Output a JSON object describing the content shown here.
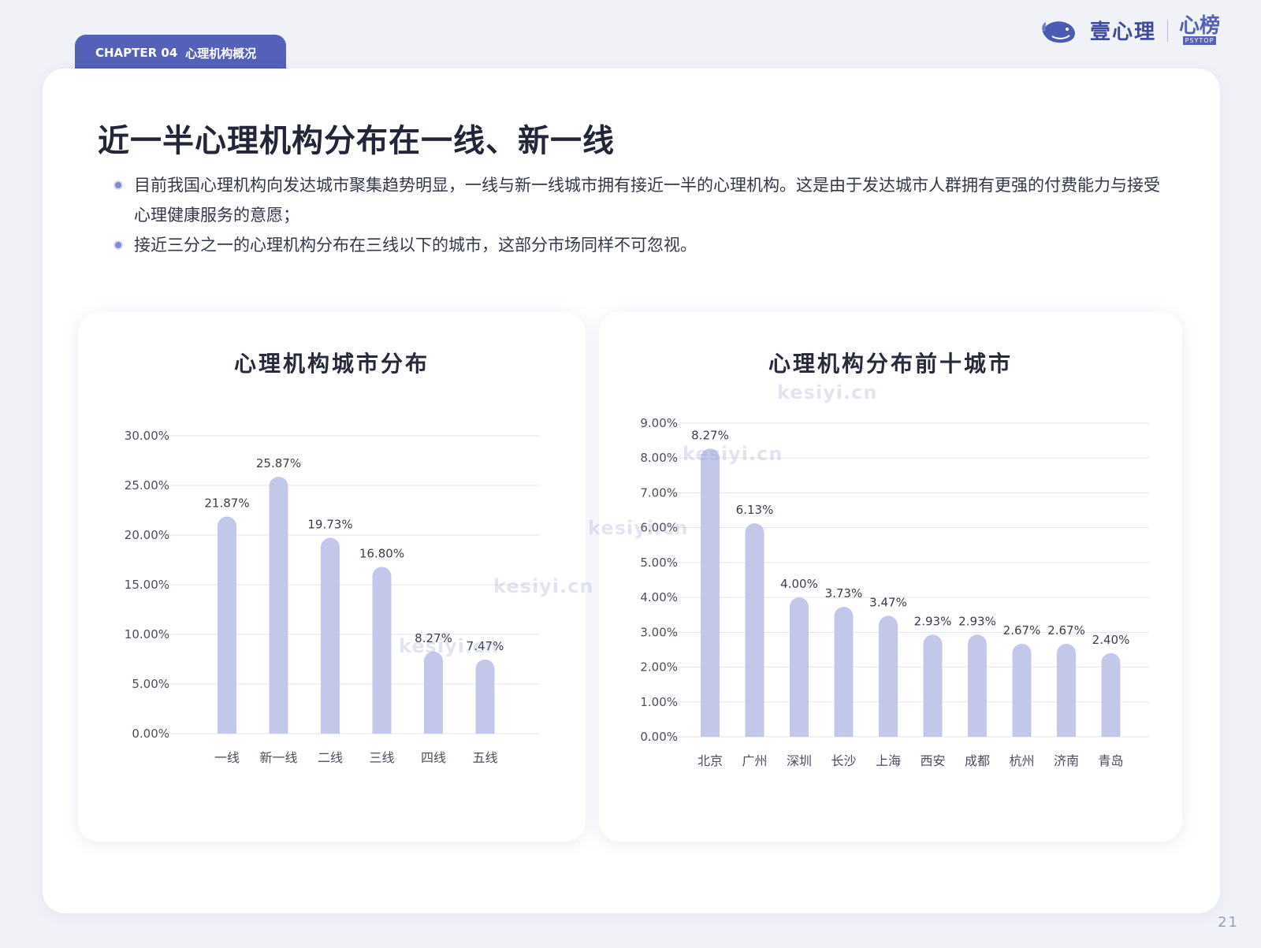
{
  "chapter": {
    "number_label": "CHAPTER 04",
    "title": "心理机构概况"
  },
  "brand": {
    "name": "壹心理",
    "logo2_text": "心榜",
    "logo2_sub": "PSYTOP"
  },
  "headline": "近一半心理机构分布在一线、新一线",
  "bullets": [
    "目前我国心理机构向发达城市聚集趋势明显，一线与新一线城市拥有接近一半的心理机构。这是由于发达城市人群拥有更强的付费能力与接受心理健康服务的意愿；",
    "接近三分之一的心理机构分布在三线以下的城市，这部分市场同样不可忽视。"
  ],
  "watermark": "kesiyi.cn",
  "page_number": "21",
  "colors": {
    "bar": "#c3c8ea",
    "accent": "#5561b8",
    "grid": "#e3e5ef"
  },
  "chart_data": [
    {
      "type": "bar",
      "title": "心理机构城市分布",
      "categories": [
        "一线",
        "新一线",
        "二线",
        "三线",
        "四线",
        "五线"
      ],
      "values": [
        21.87,
        25.87,
        19.73,
        16.8,
        8.27,
        7.47
      ],
      "value_labels": [
        "21.87%",
        "25.87%",
        "19.73%",
        "16.80%",
        "8.27%",
        "7.47%"
      ],
      "yticks": [
        "0.00%",
        "5.00%",
        "10.00%",
        "15.00%",
        "20.00%",
        "25.00%",
        "30.00%"
      ],
      "ylim": [
        0,
        30
      ],
      "grid": true,
      "xlabel": "",
      "ylabel": ""
    },
    {
      "type": "bar",
      "title": "心理机构分布前十城市",
      "categories": [
        "北京",
        "广州",
        "深圳",
        "长沙",
        "上海",
        "西安",
        "成都",
        "杭州",
        "济南",
        "青岛"
      ],
      "values": [
        8.27,
        6.13,
        4.0,
        3.73,
        3.47,
        2.93,
        2.93,
        2.67,
        2.67,
        2.4
      ],
      "value_labels": [
        "8.27%",
        "6.13%",
        "4.00%",
        "3.73%",
        "3.47%",
        "2.93%",
        "2.93%",
        "2.67%",
        "2.67%",
        "2.40%"
      ],
      "yticks": [
        "0.00%",
        "1.00%",
        "2.00%",
        "3.00%",
        "4.00%",
        "5.00%",
        "6.00%",
        "7.00%",
        "8.00%",
        "9.00%"
      ],
      "ylim": [
        0,
        9
      ],
      "grid": true,
      "xlabel": "",
      "ylabel": ""
    }
  ]
}
